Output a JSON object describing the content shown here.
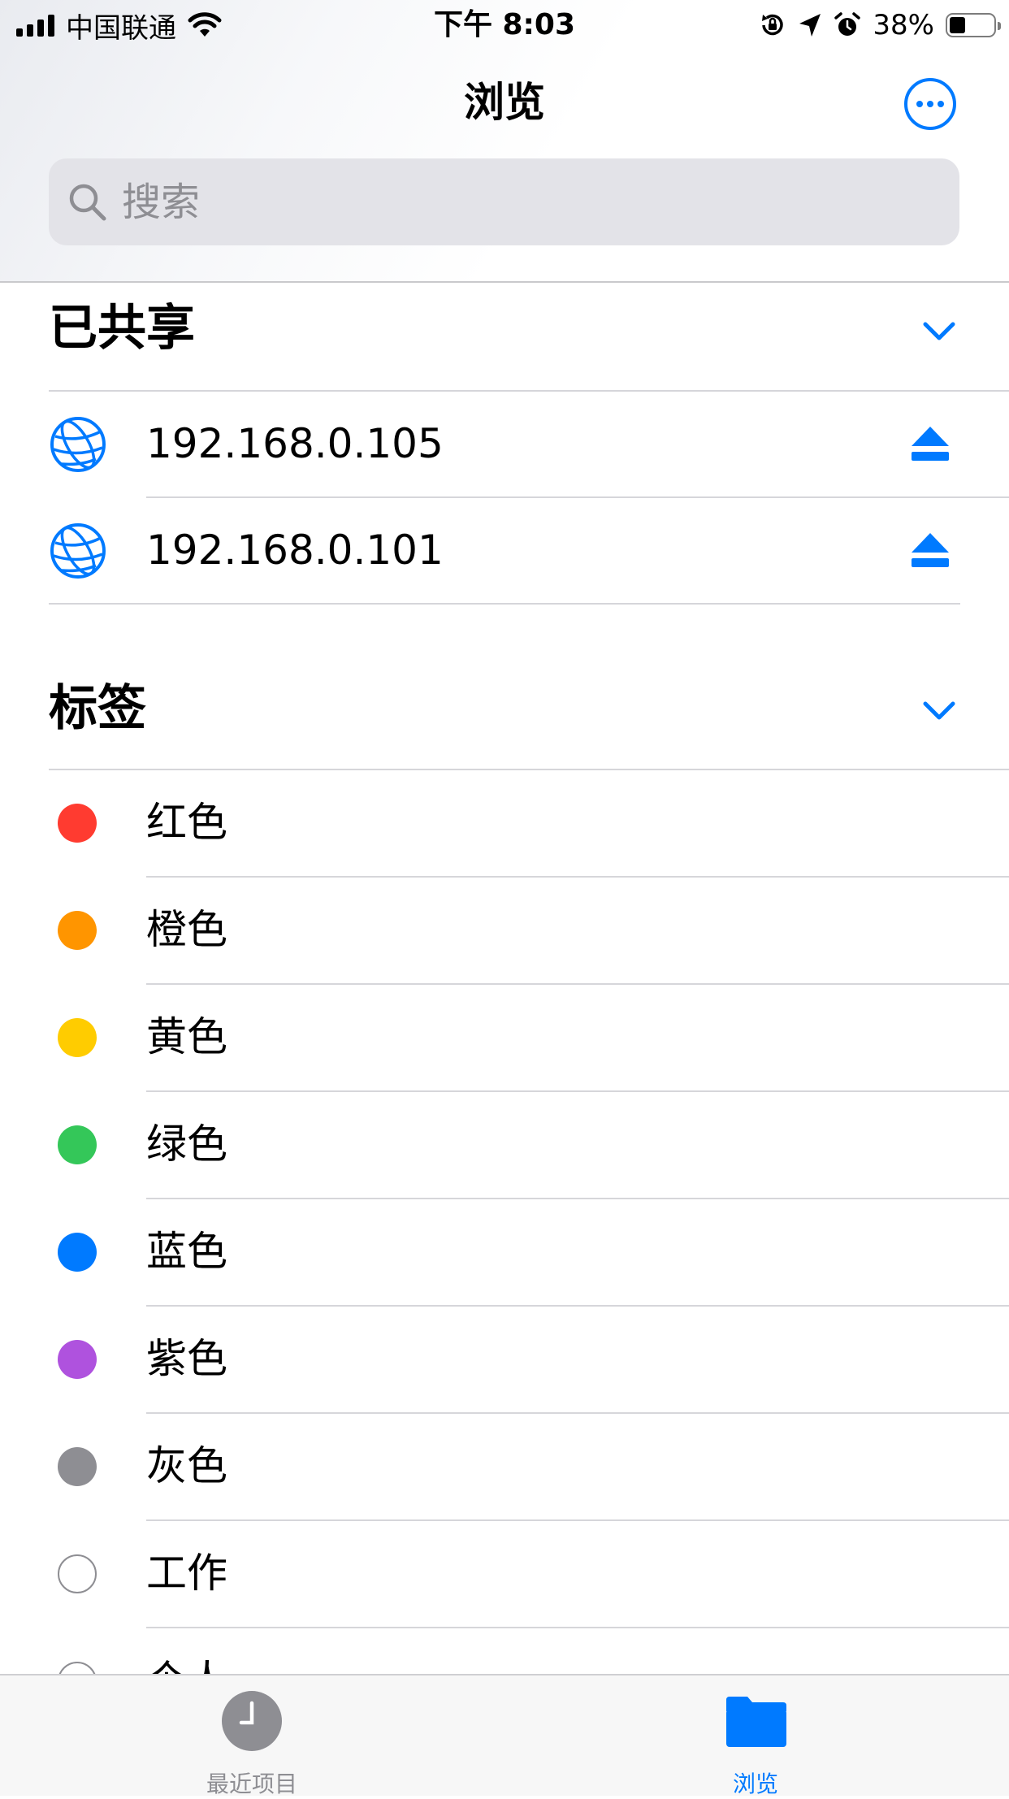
{
  "status_bar": {
    "carrier": "中国联通",
    "time": "下午 8:03",
    "battery_percent": "38%",
    "battery_level": 0.38,
    "icons": [
      "signal-icon",
      "wifi-icon",
      "orientation-lock-icon",
      "location-icon",
      "alarm-icon",
      "battery-icon"
    ]
  },
  "header": {
    "title": "浏览",
    "more_icon": "ellipsis-circle-icon"
  },
  "search": {
    "placeholder": "搜索",
    "value": ""
  },
  "shared": {
    "title": "已共享",
    "items": [
      {
        "label": "192.168.0.105",
        "icon": "globe-icon",
        "action_icon": "eject-icon"
      },
      {
        "label": "192.168.0.101",
        "icon": "globe-icon",
        "action_icon": "eject-icon"
      }
    ]
  },
  "tags": {
    "title": "标签",
    "items": [
      {
        "label": "红色",
        "color": "#ff3b30"
      },
      {
        "label": "橙色",
        "color": "#ff9500"
      },
      {
        "label": "黄色",
        "color": "#ffcc00"
      },
      {
        "label": "绿色",
        "color": "#34c759"
      },
      {
        "label": "蓝色",
        "color": "#007aff"
      },
      {
        "label": "紫色",
        "color": "#af52de"
      },
      {
        "label": "灰色",
        "color": "#8e8e93"
      },
      {
        "label": "工作",
        "color": "none"
      },
      {
        "label": "个人",
        "color": "none"
      }
    ]
  },
  "tab_bar": {
    "tabs": [
      {
        "label": "最近项目",
        "icon": "clock-icon",
        "selected": false
      },
      {
        "label": "浏览",
        "icon": "folder-icon",
        "selected": true
      }
    ]
  },
  "colors": {
    "accent": "#007aff",
    "inactive": "#8e8e93",
    "separator": "#d6d6da"
  }
}
